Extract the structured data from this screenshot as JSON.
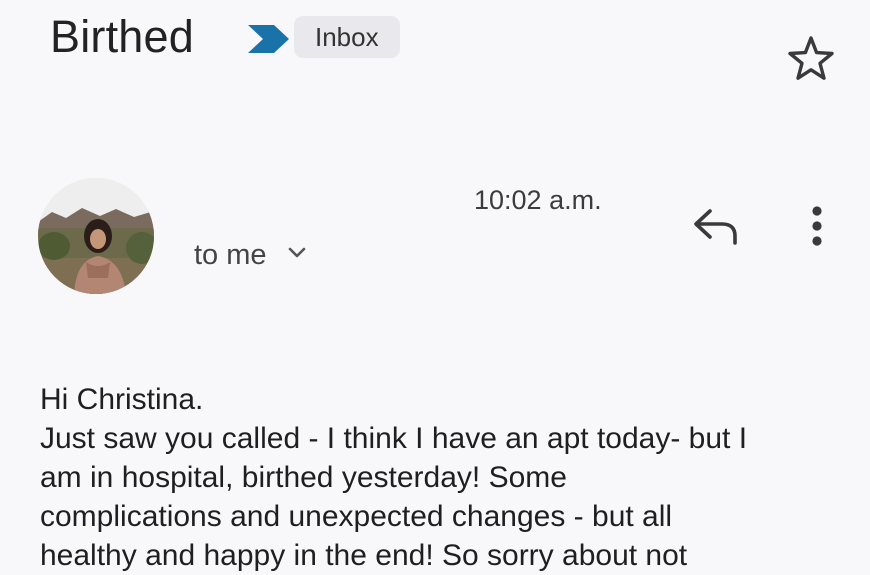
{
  "email": {
    "subject": "Birthed",
    "label": "Inbox",
    "sender_name": "",
    "recipient": "to me",
    "time": "10:02 a.m."
  },
  "body": {
    "lines": [
      "Hi Christina.",
      "Just saw you called - I think I have an apt today- but I",
      "am in hospital, birthed yesterday! Some",
      "complications and unexpected changes - but all",
      "healthy and happy in the end! So sorry about not"
    ]
  },
  "icons": {
    "importance": "importance-marker-icon",
    "star": "star-outline-icon",
    "reply": "reply-arrow-icon",
    "more": "more-vertical-icon",
    "recipient_expand": "chevron-down-icon"
  },
  "colors": {
    "background": "#f8f8fa",
    "importance_marker": "#1a73a8",
    "label_chip": "#e9e9ed",
    "text": "#1f1f1f"
  }
}
